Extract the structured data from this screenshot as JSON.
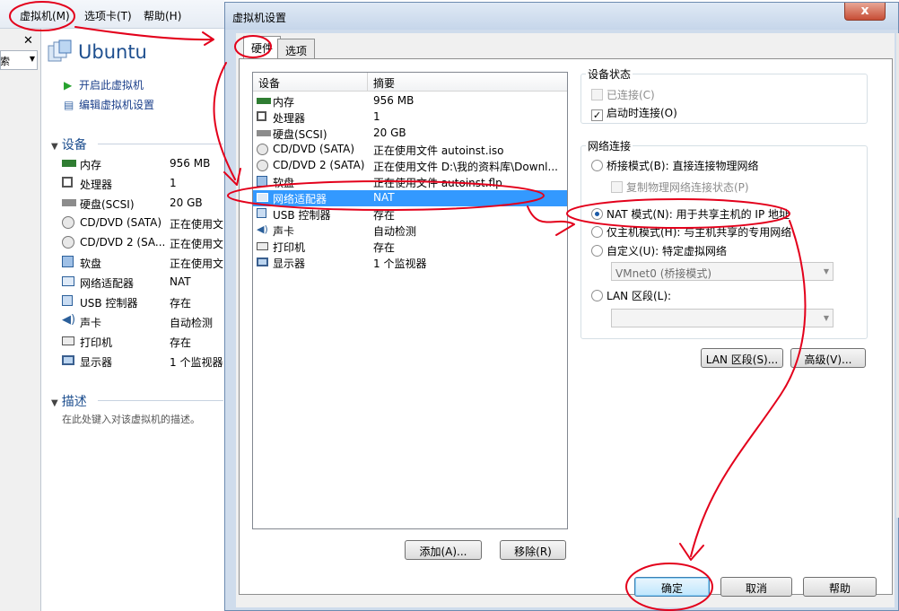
{
  "app": {
    "menu": [
      "虚拟机(M)",
      "选项卡(T)",
      "帮助(H)"
    ],
    "close_glyph": "✕",
    "search_text": "搜索",
    "vm_name": "Ubuntu",
    "actions": [
      "开启此虚拟机",
      "编辑虚拟机设置"
    ],
    "devices_heading": "设备",
    "devices": [
      {
        "name": "内存",
        "value": "956 MB",
        "icon": "memory-icon"
      },
      {
        "name": "处理器",
        "value": "1",
        "icon": "processor-icon"
      },
      {
        "name": "硬盘(SCSI)",
        "value": "20 GB",
        "icon": "hard-disk-icon"
      },
      {
        "name": "CD/DVD (SATA)",
        "value": "正在使用文",
        "icon": "cd-dvd-icon"
      },
      {
        "name": "CD/DVD 2 (SA...",
        "value": "正在使用文",
        "icon": "cd-dvd-icon"
      },
      {
        "name": "软盘",
        "value": "正在使用文",
        "icon": "floppy-icon"
      },
      {
        "name": "网络适配器",
        "value": "NAT",
        "icon": "network-icon"
      },
      {
        "name": "USB 控制器",
        "value": "存在",
        "icon": "usb-icon"
      },
      {
        "name": "声卡",
        "value": "自动检测",
        "icon": "sound-icon"
      },
      {
        "name": "打印机",
        "value": "存在",
        "icon": "printer-icon"
      },
      {
        "name": "显示器",
        "value": "1 个监视器",
        "icon": "display-icon"
      }
    ],
    "description_heading": "描述",
    "description_placeholder": "在此处键入对该虚拟机的描述。"
  },
  "dialog": {
    "title": "虚拟机设置",
    "close_glyph": "x",
    "tabs": [
      "硬件",
      "选项"
    ],
    "table": {
      "columns": [
        "设备",
        "摘要"
      ],
      "rows": [
        {
          "name": "内存",
          "value": "956 MB",
          "icon": "memory-icon"
        },
        {
          "name": "处理器",
          "value": "1",
          "icon": "processor-icon"
        },
        {
          "name": "硬盘(SCSI)",
          "value": "20 GB",
          "icon": "hard-disk-icon"
        },
        {
          "name": "CD/DVD (SATA)",
          "value": "正在使用文件 autoinst.iso",
          "icon": "cd-dvd-icon"
        },
        {
          "name": "CD/DVD 2 (SATA)",
          "value": "正在使用文件 D:\\我的资料库\\Downl...",
          "icon": "cd-dvd-icon"
        },
        {
          "name": "软盘",
          "value": "正在使用文件 autoinst.flp",
          "icon": "floppy-icon"
        },
        {
          "name": "网络适配器",
          "value": "NAT",
          "icon": "network-icon"
        },
        {
          "name": "USB 控制器",
          "value": "存在",
          "icon": "usb-icon"
        },
        {
          "name": "声卡",
          "value": "自动检测",
          "icon": "sound-icon"
        },
        {
          "name": "打印机",
          "value": "存在",
          "icon": "printer-icon"
        },
        {
          "name": "显示器",
          "value": "1 个监视器",
          "icon": "display-icon"
        }
      ],
      "selected_index": 6
    },
    "add_button": "添加(A)...",
    "remove_button": "移除(R)",
    "device_status": {
      "label": "设备状态",
      "connected": "已连接(C)",
      "connect_on_power_on": "启动时连接(O)"
    },
    "network": {
      "label": "网络连接",
      "bridged": "桥接模式(B): 直接连接物理网络",
      "replicate": "复制物理网络连接状态(P)",
      "nat": "NAT 模式(N): 用于共享主机的 IP 地址",
      "host_only": "仅主机模式(H): 与主机共享的专用网络",
      "custom": "自定义(U): 特定虚拟网络",
      "custom_value": "VMnet0 (桥接模式)",
      "lan_segment": "LAN 区段(L):",
      "lan_value": "",
      "selected": "nat"
    },
    "lan_segments_button": "LAN 区段(S)...",
    "advanced_button": "高级(V)...",
    "ok_button": "确定",
    "cancel_button": "取消",
    "help_button": "帮助"
  },
  "colors": {
    "selection": "#3399ff",
    "annotation": "#e3001b",
    "title_blue": "#1e4f8f"
  }
}
